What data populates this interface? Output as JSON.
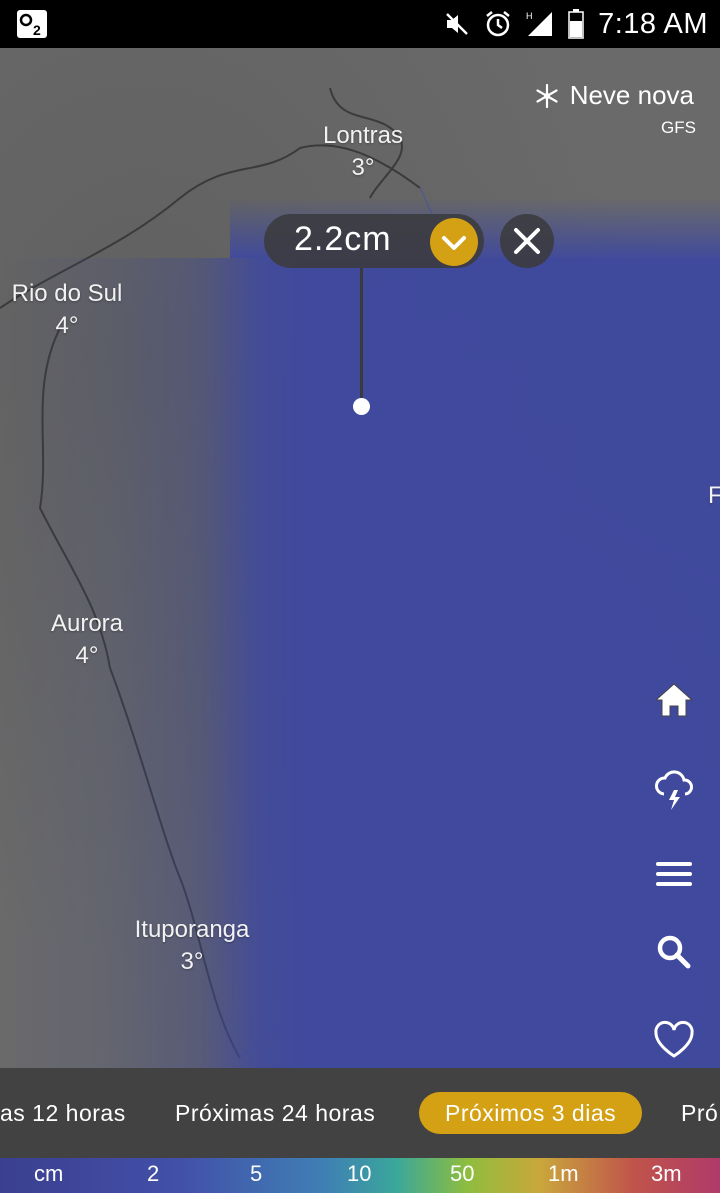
{
  "status_bar": {
    "time": "7:18 AM",
    "icons": [
      "sim-card-icon",
      "mute-icon",
      "alarm-icon",
      "signal-icon",
      "battery-icon"
    ]
  },
  "map": {
    "layer_name": "Neve nova",
    "layer_icon": "snowflake-icon",
    "model": "GFS",
    "cities": [
      {
        "name": "Lontras",
        "temp": "3°"
      },
      {
        "name": "Rio do Sul",
        "temp": "4°"
      },
      {
        "name": "Aurora",
        "temp": "4°"
      },
      {
        "name": "Ituporanga",
        "temp": "3°"
      }
    ],
    "edge_label": "F",
    "popup": {
      "value": "2.2cm"
    }
  },
  "side_buttons": [
    "home-icon",
    "storm-icon",
    "menu-icon",
    "search-icon",
    "favorite-icon"
  ],
  "tabs": [
    {
      "label": "as 12 horas",
      "active": false
    },
    {
      "label": "Próximas 24 horas",
      "active": false
    },
    {
      "label": "Próximos 3 dias",
      "active": true
    },
    {
      "label": "Pró",
      "active": false
    }
  ],
  "scale": {
    "unit": "cm",
    "ticks": [
      "2",
      "5",
      "10",
      "50",
      "1m",
      "3m"
    ]
  },
  "colors": {
    "accent": "#d4a014",
    "overlay": "#3e48a0",
    "tabs_bg": "#424242"
  }
}
